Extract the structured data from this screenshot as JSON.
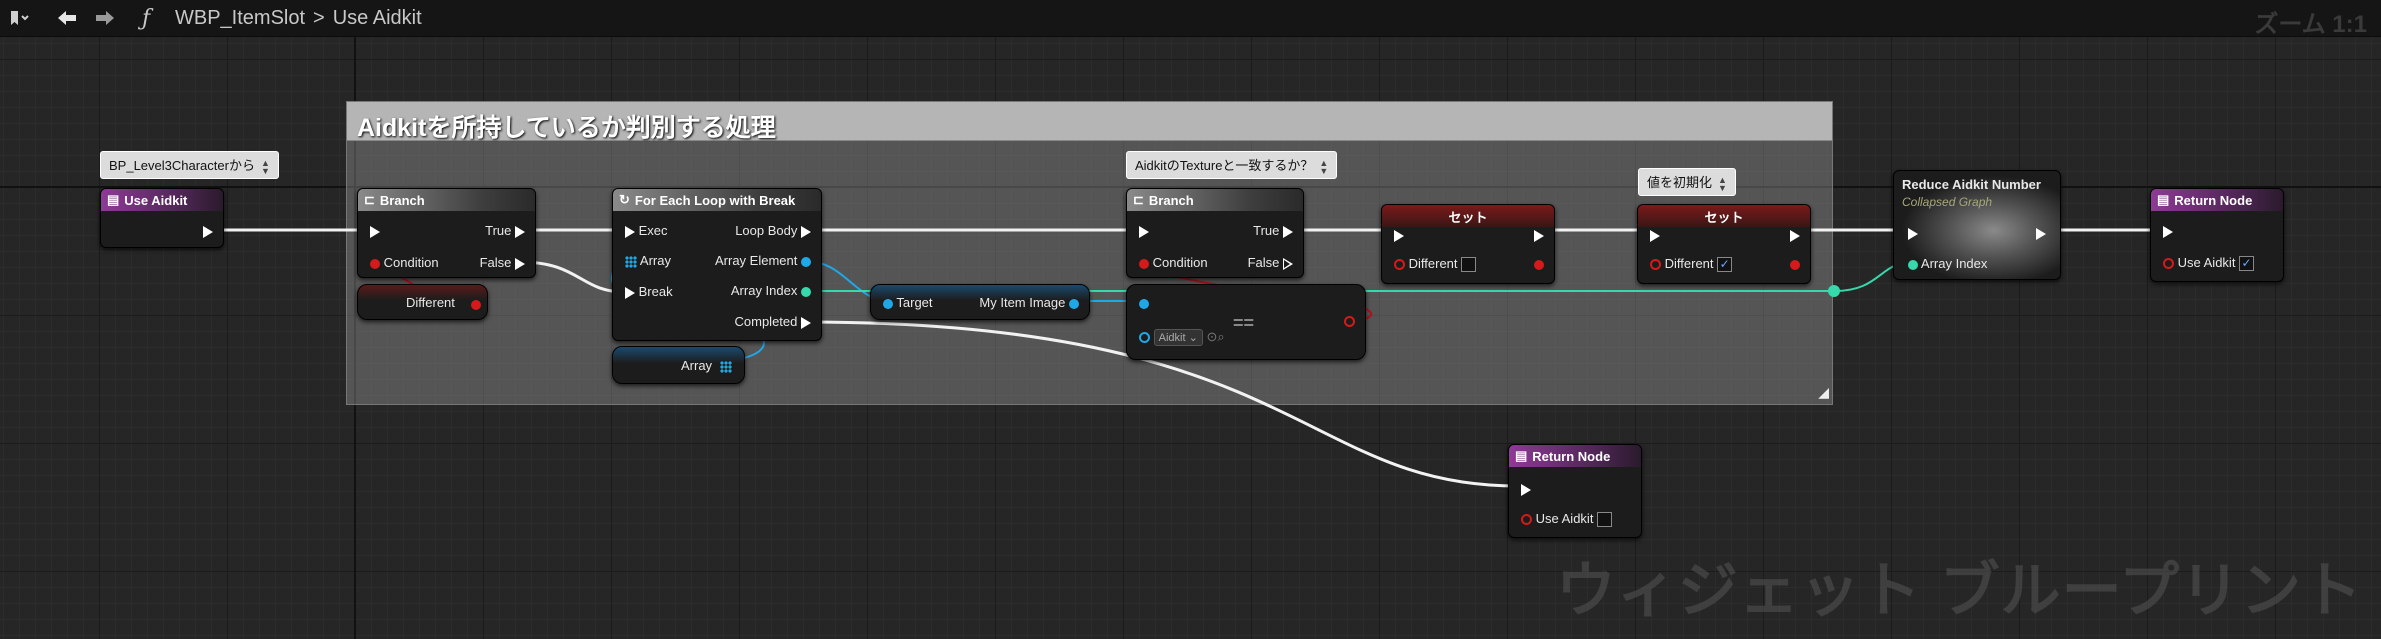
{
  "toolbar": {
    "function_glyph": "ƒ",
    "breadcrumb_parent": "WBP_ItemSlot",
    "breadcrumb_sep": ">",
    "breadcrumb_current": "Use Aidkit",
    "zoom": "ズーム 1:1"
  },
  "comment_box": {
    "title": "Aidkitを所持しているか判別する処理"
  },
  "bubbles": {
    "entry": "BP_Level3Characterから",
    "branch2": "AidkitのTextureと一致するか？",
    "set2": "値を初期化"
  },
  "nodes": {
    "entry": {
      "title": "Use Aidkit"
    },
    "branch1": {
      "title": "Branch",
      "condition": "Condition",
      "true": "True",
      "false": "False"
    },
    "different_get": {
      "label": "Different"
    },
    "foreach": {
      "title": "For Each Loop with Break",
      "exec": "Exec",
      "array": "Array",
      "break": "Break",
      "loop_body": "Loop Body",
      "array_element": "Array Element",
      "array_index": "Array Index",
      "completed": "Completed"
    },
    "array_get": {
      "label": "Array"
    },
    "target_get": {
      "target": "Target",
      "output": "My Item Image"
    },
    "branch2": {
      "title": "Branch",
      "condition": "Condition",
      "true": "True",
      "false": "False"
    },
    "equal": {
      "symbol": "==",
      "combo": "Aidkit"
    },
    "set1": {
      "title": "セット",
      "pin": "Different",
      "checked": false
    },
    "set2": {
      "title": "セット",
      "pin": "Different",
      "checked": true
    },
    "reduce": {
      "title": "Reduce Aidkit Number",
      "subtitle": "Collapsed Graph",
      "pin": "Array Index"
    },
    "return1": {
      "title": "Return Node",
      "pin": "Use Aidkit",
      "checked": true
    },
    "return2": {
      "title": "Return Node",
      "pin": "Use Aidkit",
      "checked": false
    }
  },
  "watermark": "ウィジェット ブループリント",
  "colors": {
    "exec": "#ffffff",
    "boolean": "#d41a1a",
    "object": "#1fa8e8",
    "integer": "#35d9ac",
    "function_header": "#8e3a96"
  }
}
